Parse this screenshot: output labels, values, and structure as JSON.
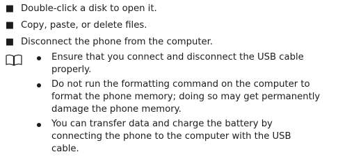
{
  "steps": [
    {
      "text": "Double-click a disk to open it."
    },
    {
      "text": "Copy, paste, or delete files."
    },
    {
      "text": "Disconnect the phone from the computer."
    }
  ],
  "note": {
    "icon": "open-book-icon",
    "items": [
      {
        "lines": [
          "Ensure that you connect and disconnect the USB cable",
          "properly."
        ]
      },
      {
        "lines": [
          "Do not run the formatting command on the computer to",
          "format the phone memory; doing so may get permanently",
          "damage the phone memory."
        ]
      },
      {
        "lines": [
          "You can transfer data and charge the battery by",
          "connecting the phone to the computer with the USB",
          "cable."
        ]
      }
    ]
  }
}
